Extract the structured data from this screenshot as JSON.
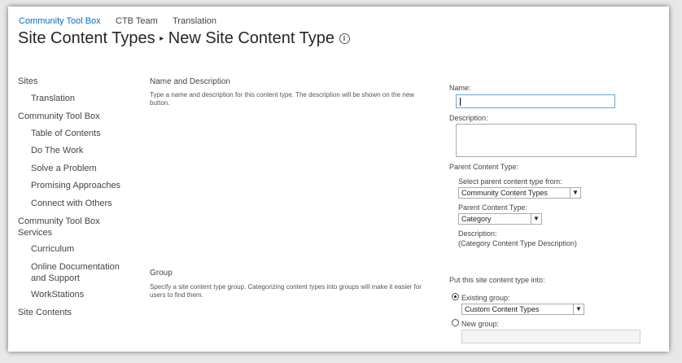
{
  "topnav": {
    "items": [
      "Community Tool Box",
      "CTB Team",
      "Translation"
    ]
  },
  "title": {
    "parent": "Site Content Types",
    "separator": "▸",
    "current": "New Site Content Type",
    "info_icon": "ⓘ"
  },
  "sidebar": {
    "items": [
      {
        "label": "Sites"
      },
      {
        "label": "Translation"
      },
      {
        "label": "Community Tool Box"
      },
      {
        "label": "Table of Contents"
      },
      {
        "label": "Do The Work"
      },
      {
        "label": "Solve a Problem"
      },
      {
        "label": "Promising Approaches"
      },
      {
        "label": "Connect with Others"
      },
      {
        "label": "Community Tool Box Services"
      },
      {
        "label": "Curriculum"
      },
      {
        "label": "Online Documentation and Support"
      },
      {
        "label": "WorkStations"
      },
      {
        "label": "Site Contents"
      }
    ]
  },
  "sections": {
    "name_desc": {
      "title": "Name and Description",
      "description": "Type a name and description for this content type. The description will be shown on the new button."
    },
    "group": {
      "title": "Group",
      "description": "Specify a site content type group. Categorizing content types into groups will make it easier for users to find them."
    }
  },
  "form": {
    "name_label": "Name:",
    "name_value": "",
    "description_label": "Description:",
    "description_value": "",
    "parent_content_type_label": "Parent Content Type:",
    "select_parent_label": "Select parent content type from:",
    "select_parent_value": "Community Content Types",
    "parent_ct_label": "Parent Content Type:",
    "parent_ct_value": "Category",
    "desc_label": "Description:",
    "desc_value": "(Category Content Type Description)",
    "put_into_label": "Put this site content type into:",
    "existing_group_label": "Existing group:",
    "existing_group_value": "Custom Content Types",
    "new_group_label": "New group:",
    "new_group_value": "",
    "existing_group_selected": true
  }
}
